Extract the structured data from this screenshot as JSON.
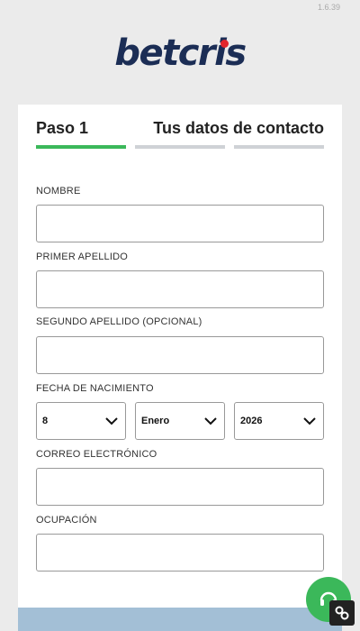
{
  "app": {
    "version": "1.6.39",
    "logo_text": "betcris",
    "colors": {
      "brand_navy": "#1b2d55",
      "brand_red": "#e2262c",
      "accent_green": "#3bb85a",
      "bottom_bar": "#a3bfd6"
    }
  },
  "step": {
    "label": "Paso 1",
    "title": "Tus datos de contacto",
    "progress": {
      "total": 3,
      "completed": 1
    }
  },
  "form": {
    "nombre": {
      "label": "NOMBRE",
      "value": "",
      "placeholder": ""
    },
    "primer_apellido": {
      "label": "PRIMER APELLIDO",
      "value": "",
      "placeholder": ""
    },
    "segundo_apellido": {
      "label": "SEGUNDO APELLIDO (OPCIONAL)",
      "value": "",
      "placeholder": ""
    },
    "fecha_nacimiento": {
      "label": "FECHA DE NACIMIENTO",
      "day": "8",
      "month": "Enero",
      "year": "2026"
    },
    "correo": {
      "label": "CORREO ELECTRÓNICO",
      "value": "",
      "placeholder": ""
    },
    "ocupacion": {
      "label": "OCUPACIÓN",
      "value": "",
      "placeholder": ""
    }
  },
  "icons": {
    "support": "headset-icon",
    "link": "link-icon",
    "select_chevron": "chevron-down-icon"
  }
}
